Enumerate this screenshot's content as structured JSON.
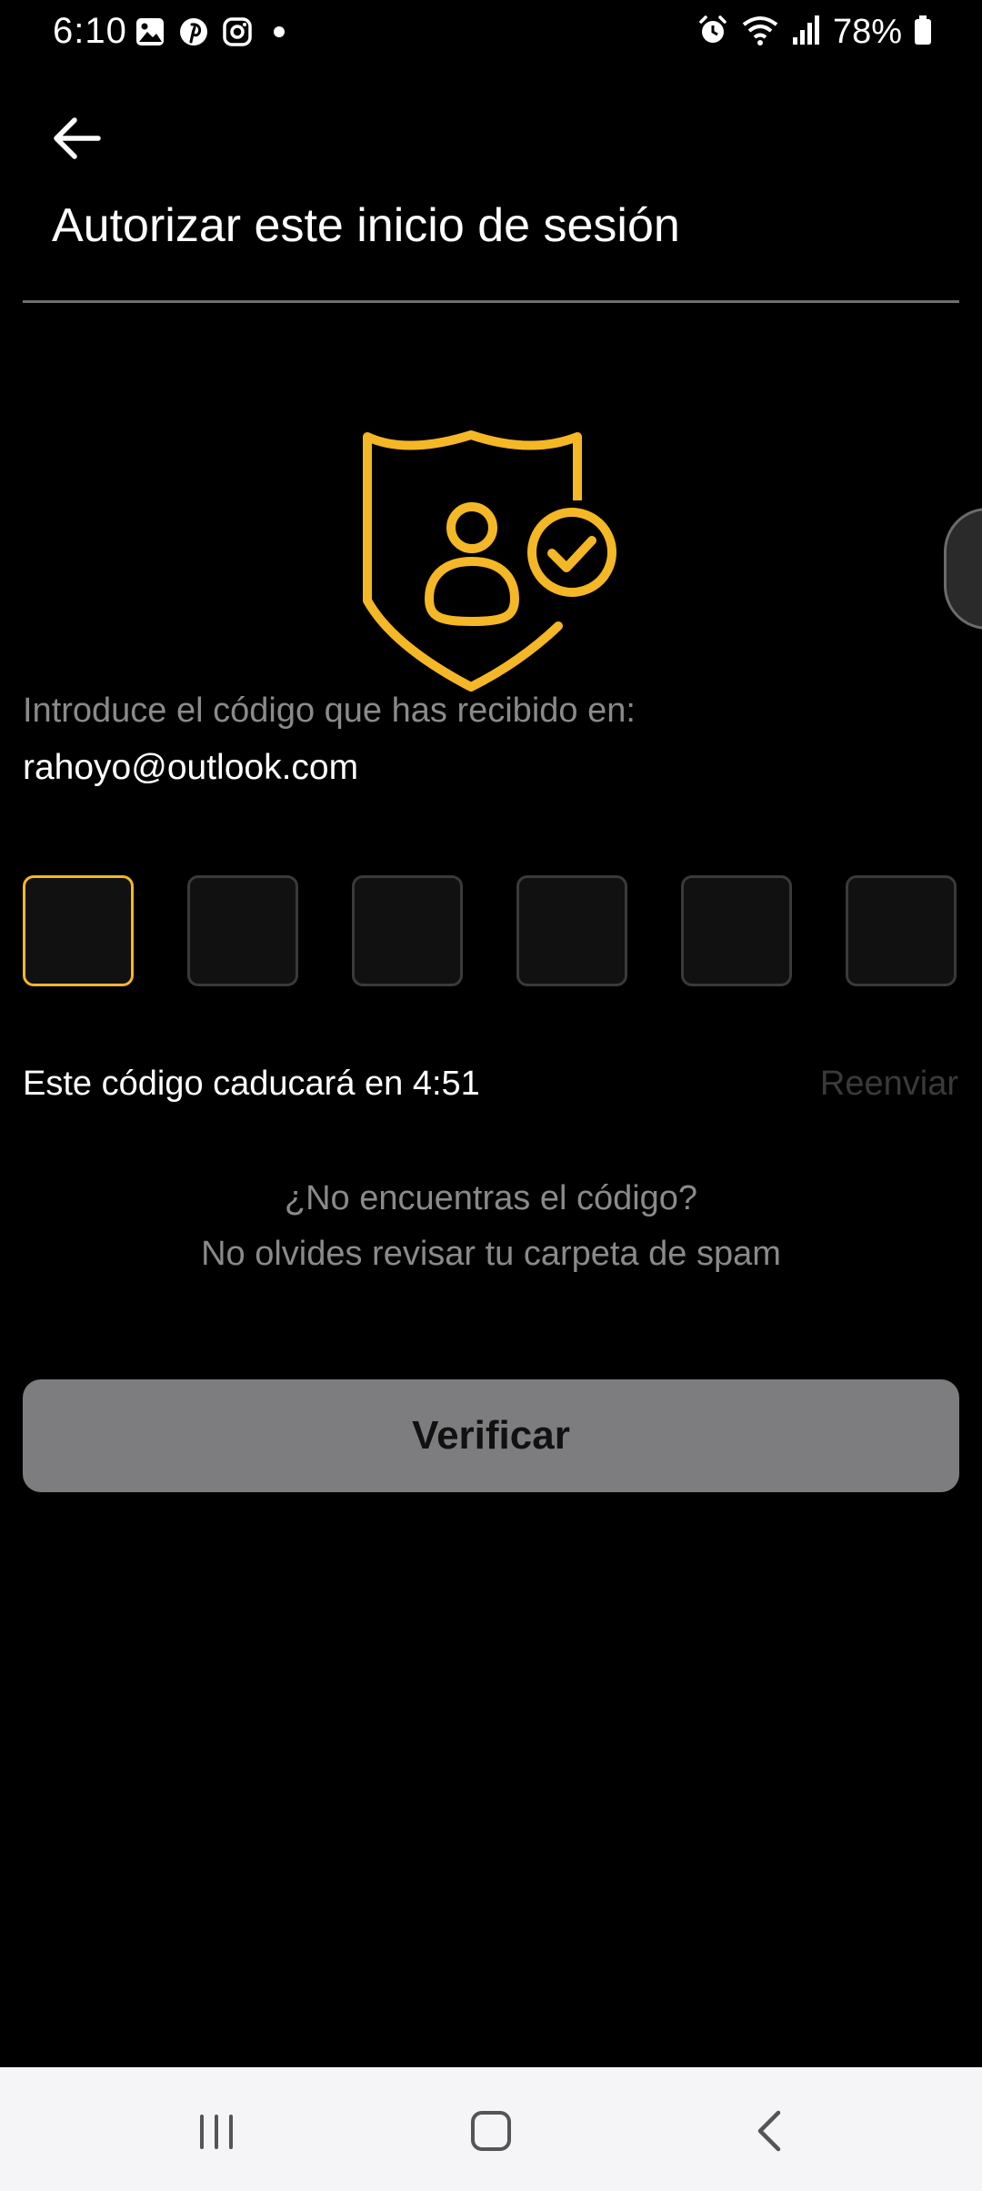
{
  "status_bar": {
    "time": "6:10",
    "battery": "78%",
    "left_icons": [
      "gallery-icon",
      "pinterest-icon",
      "instagram-icon",
      "dot-icon"
    ],
    "right_icons": [
      "alarm-icon",
      "wifi-icon",
      "signal-icon",
      "battery-icon"
    ]
  },
  "header": {
    "title": "Autorizar este inicio de sesión"
  },
  "prompt": {
    "intro": "Introduce el código que has recibido en:",
    "email": "rahoyo@outlook.com"
  },
  "code": {
    "digits": [
      "",
      "",
      "",
      "",
      "",
      ""
    ]
  },
  "expiry": {
    "text": "Este código caducará en 4:51",
    "resend_label": "Reenviar"
  },
  "help": {
    "line1": "¿No encuentras el código?",
    "line2": "No olvides revisar tu carpeta de spam"
  },
  "actions": {
    "verify_label": "Verificar"
  },
  "colors": {
    "accent": "#f4b726",
    "background": "#000000",
    "button_disabled": "#7d7d80"
  }
}
